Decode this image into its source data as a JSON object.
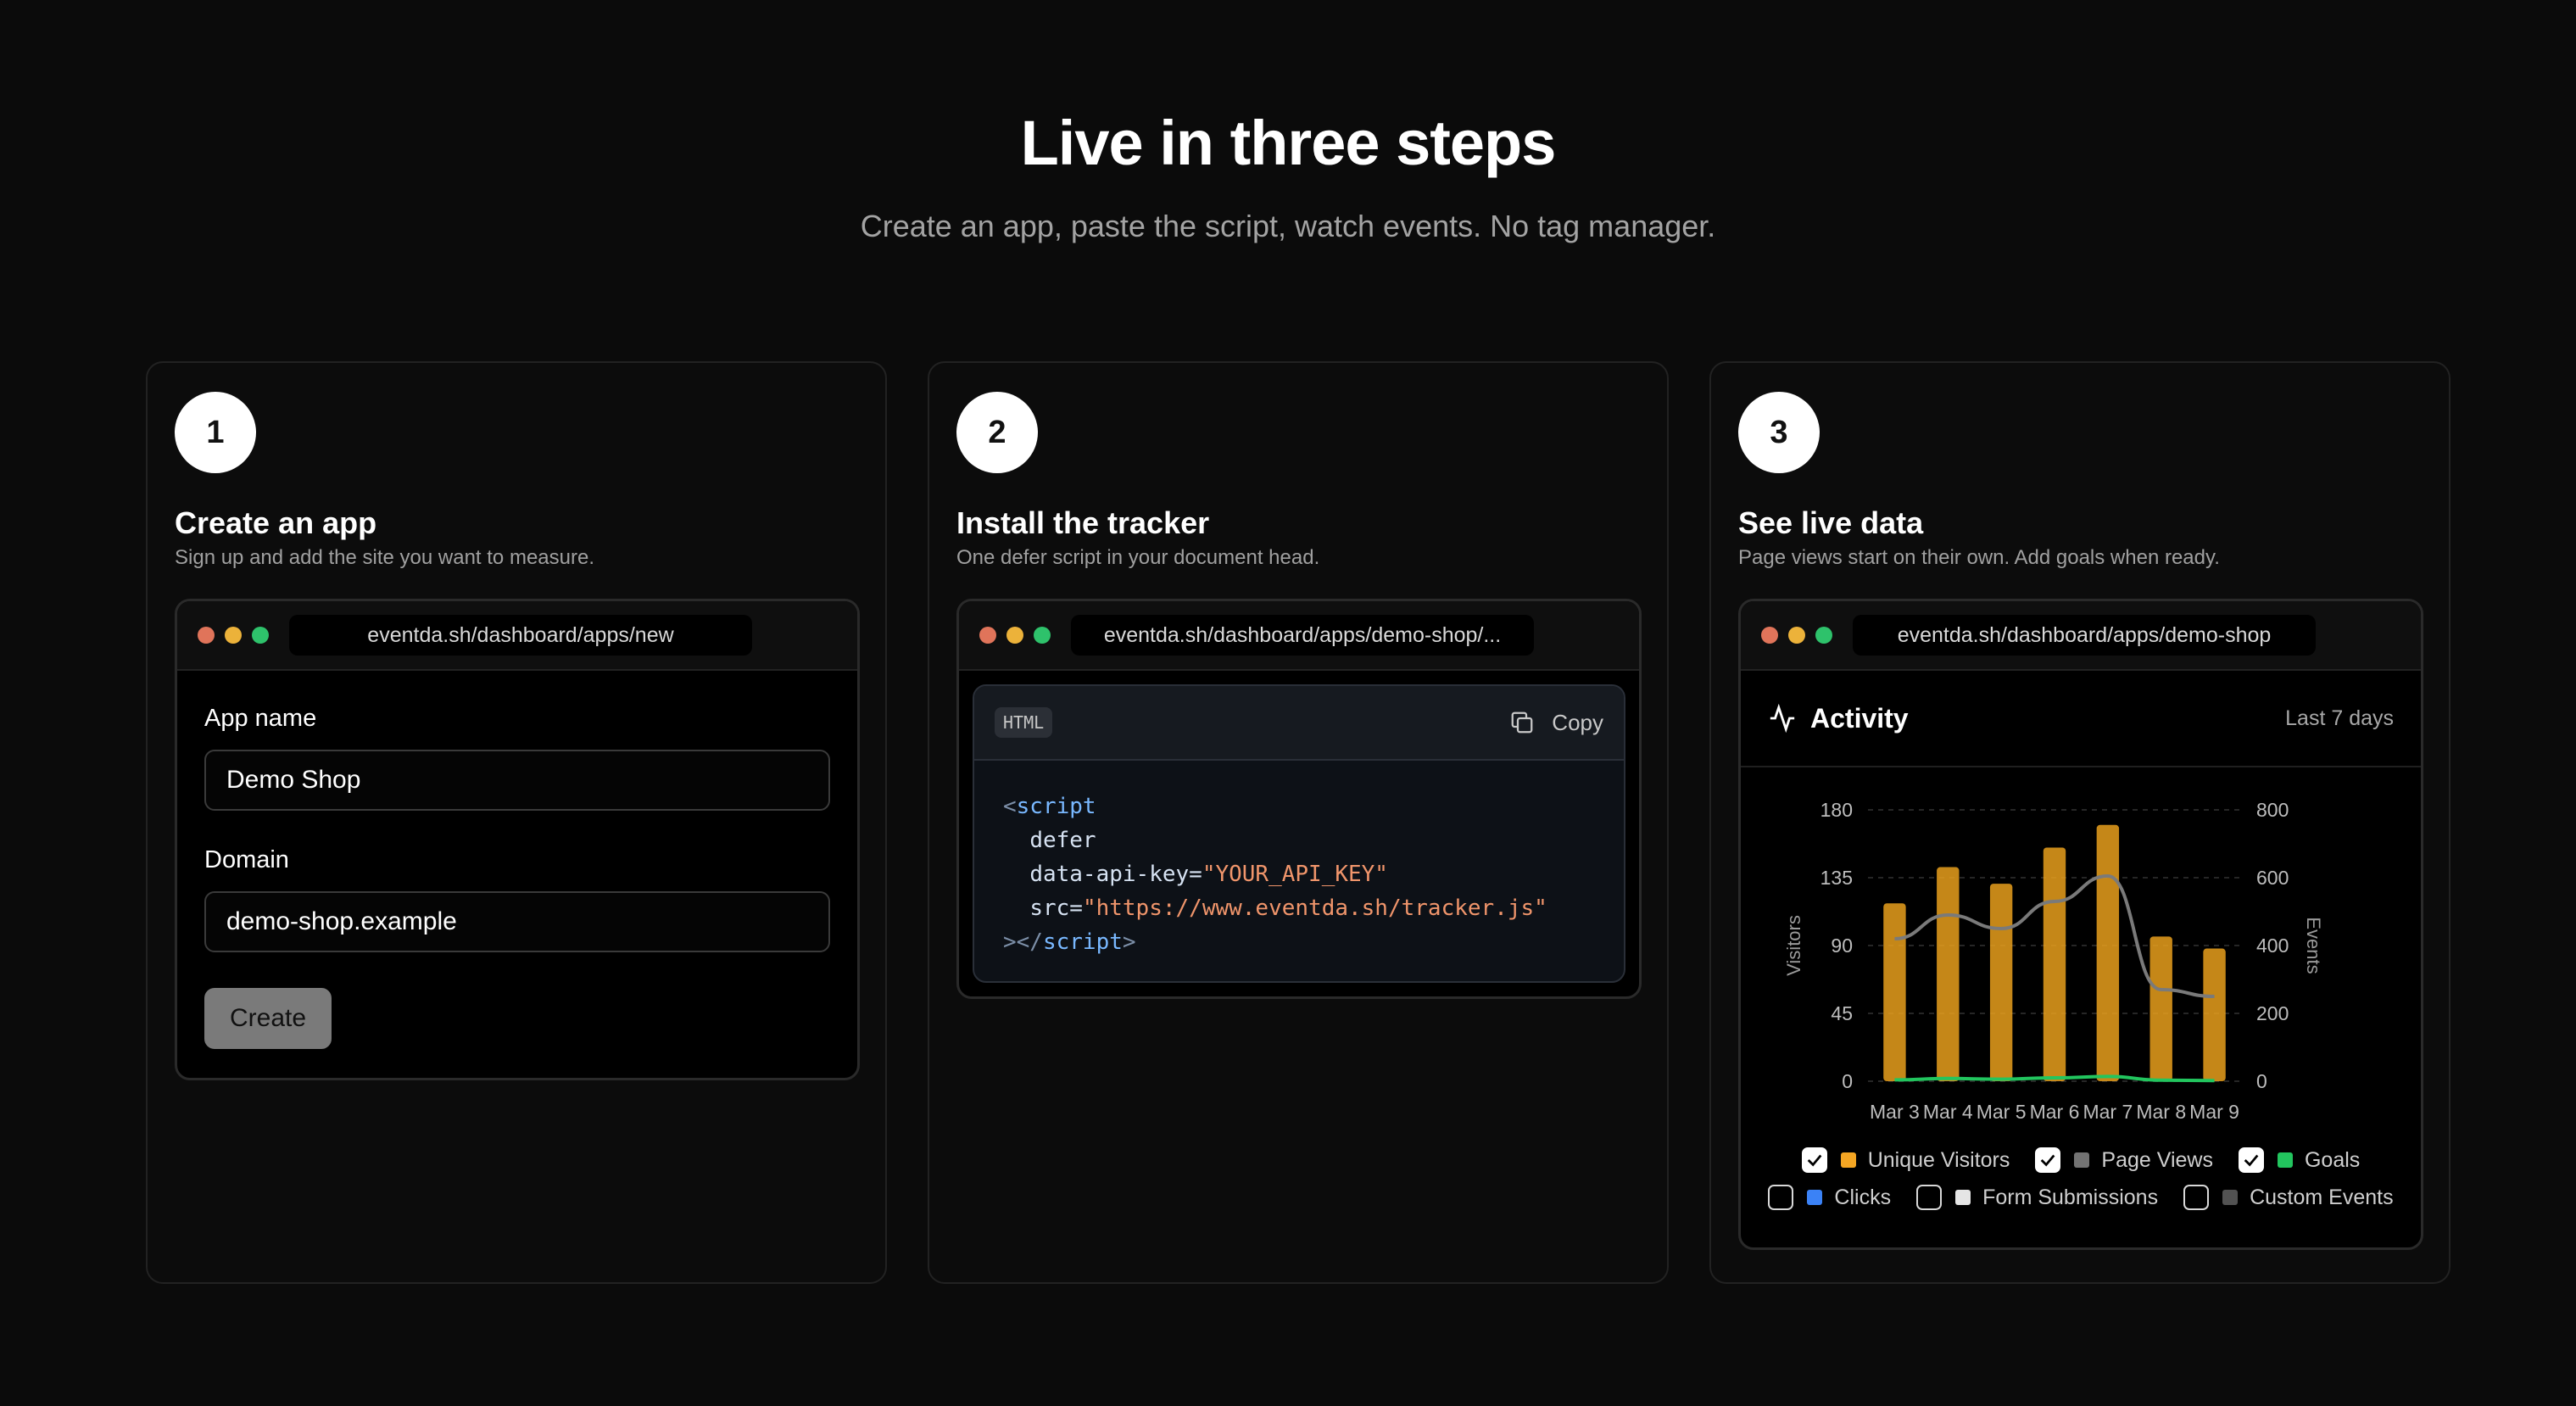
{
  "header": {
    "title": "Live in three steps",
    "subtitle": "Create an app, paste the script, watch events. No tag manager."
  },
  "steps": [
    {
      "number": "1",
      "title": "Create an app",
      "description": "Sign up and add the site you want to measure.",
      "url": "eventda.sh/dashboard/apps/new",
      "form": {
        "app_name_label": "App name",
        "app_name_value": "Demo Shop",
        "domain_label": "Domain",
        "domain_value": "demo-shop.example",
        "create_label": "Create"
      }
    },
    {
      "number": "2",
      "title": "Install the tracker",
      "description": "One defer script in your document head.",
      "url": "eventda.sh/dashboard/apps/demo-shop/...",
      "code": {
        "language": "HTML",
        "copy_label": "Copy",
        "line1_open": "<",
        "line1_tag": "script",
        "line2_attr": "defer",
        "line3_attr": "data-api-key=",
        "line3_value": "\"YOUR_API_KEY\"",
        "line4_attr": "src=",
        "line4_value": "\"https://www.eventda.sh/tracker.js\"",
        "line5_open": "></",
        "line5_tag": "script",
        "line5_close": ">"
      }
    },
    {
      "number": "3",
      "title": "See live data",
      "description": "Page views start on their own. Add goals when ready.",
      "url": "eventda.sh/dashboard/apps/demo-shop",
      "activity_title": "Activity",
      "range_label": "Last 7 days",
      "legend": [
        {
          "label": "Unique Visitors",
          "checked": true,
          "color": "#f5a623"
        },
        {
          "label": "Page Views",
          "checked": true,
          "color": "#737373"
        },
        {
          "label": "Goals",
          "checked": true,
          "color": "#22c55e"
        },
        {
          "label": "Clicks",
          "checked": false,
          "color": "#3b82f6"
        },
        {
          "label": "Form Submissions",
          "checked": false,
          "color": "#e5e5e5"
        },
        {
          "label": "Custom Events",
          "checked": false,
          "color": "#525252"
        }
      ]
    }
  ],
  "chart_data": {
    "type": "bar",
    "categories": [
      "Mar 3",
      "Mar 4",
      "Mar 5",
      "Mar 6",
      "Mar 7",
      "Mar 8",
      "Mar 9"
    ],
    "ylabel": "Visitors",
    "y2label": "Events",
    "ylim": [
      0,
      180
    ],
    "y2lim": [
      0,
      800
    ],
    "yticks": [
      0,
      45,
      90,
      135,
      180
    ],
    "y2ticks": [
      0,
      200,
      400,
      600,
      800
    ],
    "series": [
      {
        "name": "Unique Visitors",
        "type": "bar",
        "axis": "left",
        "color": "#f5a623",
        "values": [
          118,
          142,
          131,
          155,
          170,
          96,
          88
        ]
      },
      {
        "name": "Page Views",
        "type": "line",
        "axis": "right",
        "color": "#7a7a7a",
        "values": [
          420,
          490,
          450,
          530,
          605,
          270,
          250
        ]
      },
      {
        "name": "Goals",
        "type": "line",
        "axis": "right",
        "color": "#22c55e",
        "values": [
          4,
          8,
          6,
          10,
          14,
          3,
          2
        ]
      }
    ],
    "grid": true
  }
}
